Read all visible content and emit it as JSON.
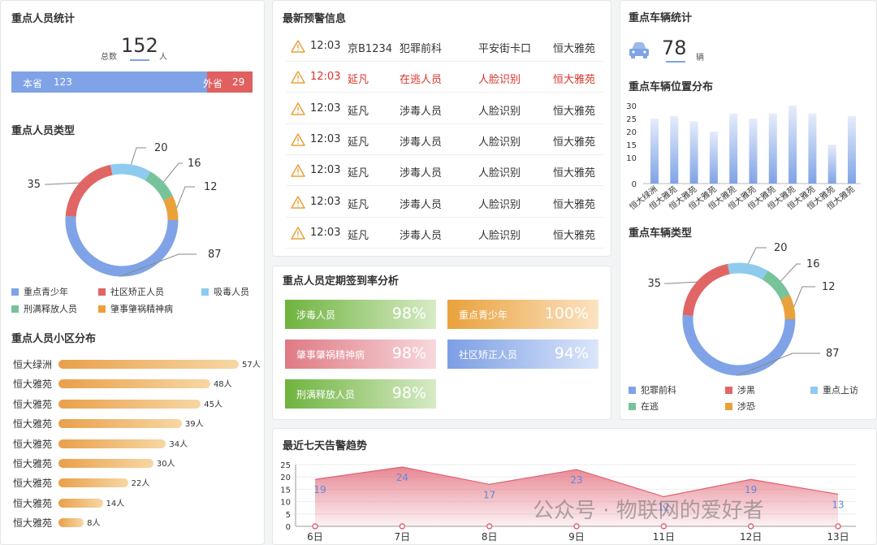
{
  "persons": {
    "title": "重点人员统计",
    "total_label": "总数",
    "total_value": "152",
    "total_unit": "人",
    "local_label": "本省",
    "local_value": "123",
    "other_label": "外省",
    "other_value": "29",
    "local_fraction": 0.81
  },
  "person_types": {
    "title": "重点人员类型",
    "chart_data": {
      "type": "pie",
      "values": [
        87,
        35,
        20,
        16,
        12
      ],
      "labels": [
        "87",
        "35",
        "20",
        "16",
        "12"
      ],
      "colors": [
        "#7fa3e6",
        "#e06666",
        "#8ecbef",
        "#78c39a",
        "#e9a13b"
      ]
    },
    "legend": [
      {
        "label": "重点青少年",
        "color": "#7fa3e6"
      },
      {
        "label": "社区矫正人员",
        "color": "#e06666"
      },
      {
        "label": "吸毒人员",
        "color": "#8ecbef"
      },
      {
        "label": "刑满释放人员",
        "color": "#78c39a"
      },
      {
        "label": "肇事肇祸精神病",
        "color": "#e9a13b"
      }
    ]
  },
  "community": {
    "title": "重点人员小区分布",
    "chart_data": {
      "type": "bar",
      "categories": [
        "恒大绿洲",
        "恒大雅苑",
        "恒大雅苑",
        "恒大雅苑",
        "恒大雅苑",
        "恒大雅苑",
        "恒大雅苑",
        "恒大雅苑",
        "恒大雅苑"
      ],
      "values": [
        57,
        48,
        45,
        39,
        34,
        30,
        22,
        14,
        8
      ],
      "value_labels": [
        "57人",
        "48人",
        "45人",
        "39人",
        "34人",
        "30人",
        "22人",
        "14人",
        "8人"
      ],
      "max": 57
    }
  },
  "alerts": {
    "title": "最新预警信息",
    "rows": [
      {
        "time": "12:03",
        "name": "京B1234",
        "type": "犯罪前科",
        "source": "平安街卡口",
        "place": "恒大雅苑",
        "color": "#333333"
      },
      {
        "time": "12:03",
        "name": "延凡",
        "type": "在逃人员",
        "source": "人脸识别",
        "place": "恒大雅苑",
        "color": "#d9342b"
      },
      {
        "time": "12:03",
        "name": "延凡",
        "type": "涉毒人员",
        "source": "人脸识别",
        "place": "恒大雅苑",
        "color": "#333333"
      },
      {
        "time": "12:03",
        "name": "延凡",
        "type": "涉毒人员",
        "source": "人脸识别",
        "place": "恒大雅苑",
        "color": "#333333"
      },
      {
        "time": "12:03",
        "name": "延凡",
        "type": "涉毒人员",
        "source": "人脸识别",
        "place": "恒大雅苑",
        "color": "#333333"
      },
      {
        "time": "12:03",
        "name": "延凡",
        "type": "涉毒人员",
        "source": "人脸识别",
        "place": "恒大雅苑",
        "color": "#333333"
      },
      {
        "time": "12:03",
        "name": "延凡",
        "type": "涉毒人员",
        "source": "人脸识别",
        "place": "恒大雅苑",
        "color": "#333333"
      }
    ]
  },
  "signin": {
    "title": "重点人员定期签到率分析",
    "items": [
      {
        "label": "涉毒人员",
        "value": "98%",
        "from": "#6fb33e",
        "to": "#d7ebc6"
      },
      {
        "label": "重点青少年",
        "value": "100%",
        "from": "#e9a13b",
        "to": "#fbe3c2"
      },
      {
        "label": "肇事肇祸精神病",
        "value": "98%",
        "from": "#df7a84",
        "to": "#f7d8dc"
      },
      {
        "label": "社区矫正人员",
        "value": "94%",
        "from": "#7c9ee4",
        "to": "#dbe6fa"
      },
      {
        "label": "刑满释放人员",
        "value": "98%",
        "from": "#6fb33e",
        "to": "#d7ebc6"
      }
    ]
  },
  "trend": {
    "title": "最近七天告警趋势",
    "chart_data": {
      "type": "area",
      "categories": [
        "6日",
        "7日",
        "8日",
        "9日",
        "11日",
        "12日",
        "13日"
      ],
      "values": [
        19,
        24,
        17,
        23,
        12,
        19,
        13
      ],
      "ylim": [
        0,
        25
      ],
      "yticks": [
        0,
        5,
        10,
        15,
        20,
        25
      ],
      "color": "#e06070"
    }
  },
  "vehicles": {
    "title": "重点车辆统计",
    "count": "78",
    "unit": "辆"
  },
  "vehicle_pos": {
    "title": "重点车辆位置分布",
    "chart_data": {
      "type": "bar",
      "categories": [
        "恒大绿洲",
        "恒大雅苑",
        "恒大雅苑",
        "恒大雅苑",
        "恒大雅苑",
        "恒大雅苑",
        "恒大雅苑",
        "恒大雅苑",
        "恒大雅苑",
        "恒大雅苑",
        "恒大雅苑"
      ],
      "values": [
        25,
        26,
        24,
        20,
        27,
        25,
        27,
        30,
        27,
        15,
        26
      ],
      "ylim": [
        0,
        30
      ],
      "yticks": [
        0,
        10,
        15,
        20,
        25,
        30
      ],
      "color": "#7fa3e6"
    }
  },
  "vehicle_types": {
    "title": "重点车辆类型",
    "chart_data": {
      "type": "pie",
      "values": [
        87,
        35,
        20,
        16,
        12
      ],
      "labels": [
        "87",
        "35",
        "20",
        "16",
        "12"
      ],
      "colors": [
        "#7fa3e6",
        "#e06666",
        "#8ecbef",
        "#78c39a",
        "#e9a13b"
      ]
    },
    "legend": [
      {
        "label": "犯罪前科",
        "color": "#7fa3e6"
      },
      {
        "label": "涉黑",
        "color": "#e06666"
      },
      {
        "label": "重点上访",
        "color": "#8ecbef"
      },
      {
        "label": "在逃",
        "color": "#78c39a"
      },
      {
        "label": "涉恐",
        "color": "#e9a13b"
      }
    ]
  },
  "watermark": "公众号 · 物联网的爱好者"
}
